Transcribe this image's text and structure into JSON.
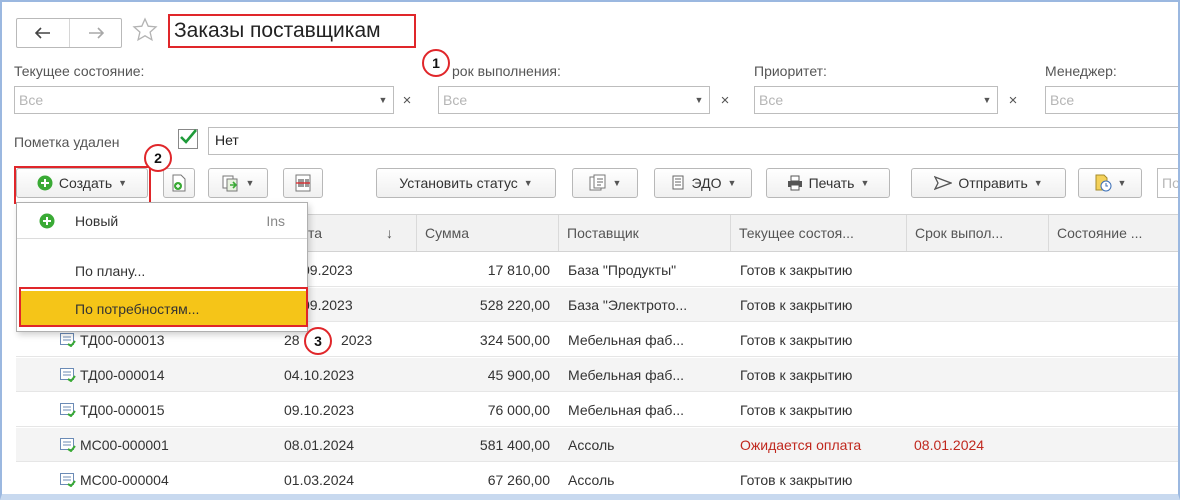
{
  "window": {
    "title": "Заказы поставщикам"
  },
  "nav": {
    "back_icon": "arrow-left-icon",
    "forward_icon": "arrow-right-icon",
    "favorite_icon": "star-icon"
  },
  "filters": [
    {
      "label": "Текущее состояние:",
      "placeholder": "Все"
    },
    {
      "label": "Срок выполнения:",
      "label_visible": "рок выполнения:",
      "placeholder": "Все"
    },
    {
      "label": "Приоритет:",
      "placeholder": "Все"
    },
    {
      "label": "Менеджер:",
      "placeholder": "Все"
    }
  ],
  "deletion_mark": {
    "label": "Пометка удален",
    "checked": true,
    "value": "Нет"
  },
  "toolbar": {
    "create_label": "Создать",
    "set_status_label": "Установить статус",
    "edo_label": "ЭДО",
    "print_label": "Печать",
    "send_label": "Отправить",
    "search_placeholder": "По"
  },
  "create_menu": {
    "items": [
      {
        "label": "Новый",
        "shortcut": "Ins"
      },
      {
        "label": "По плану..."
      },
      {
        "label": "По потребностям..."
      }
    ]
  },
  "table": {
    "columns": [
      "та",
      "↓",
      "Сумма",
      "Поставщик",
      "Текущее состоя...",
      "Срок выпол...",
      "Состояние ..."
    ],
    "rows": [
      {
        "number": "",
        "date": "09.2023",
        "sum": "17 810,00",
        "supplier": "База \"Продукты\"",
        "state": "Готов к закрытию",
        "deadline": ""
      },
      {
        "number": "",
        "date": "09.2023",
        "sum": "528 220,00",
        "supplier": "База \"Электрото...",
        "state": "Готов к закрытию",
        "deadline": ""
      },
      {
        "number": "ТД00-000013",
        "date": "28",
        "date_tail": "2023",
        "sum": "324 500,00",
        "supplier": "Мебельная фаб...",
        "state": "Готов к закрытию",
        "deadline": ""
      },
      {
        "number": "ТД00-000014",
        "date": "04.10.2023",
        "sum": "45 900,00",
        "supplier": "Мебельная фаб...",
        "state": "Готов к закрытию",
        "deadline": ""
      },
      {
        "number": "ТД00-000015",
        "date": "09.10.2023",
        "sum": "76 000,00",
        "supplier": "Мебельная фаб...",
        "state": "Готов к закрытию",
        "deadline": ""
      },
      {
        "number": "МС00-000001",
        "date": "08.01.2024",
        "sum": "581 400,00",
        "supplier": "Ассоль",
        "state": "Ожидается оплата",
        "deadline": "08.01.2024"
      },
      {
        "number": "МС00-000004",
        "date": "01.03.2024",
        "sum": "67 260,00",
        "supplier": "Ассоль",
        "state": "Готов к закрытию",
        "deadline": ""
      }
    ]
  },
  "callouts": [
    "1",
    "2",
    "3"
  ],
  "colors": {
    "highlight": "#f5c518",
    "annotation": "#e0262a",
    "overdue_text": "#c0281e",
    "check": "#1f9b3a",
    "create_icon": "#3aaa35"
  }
}
